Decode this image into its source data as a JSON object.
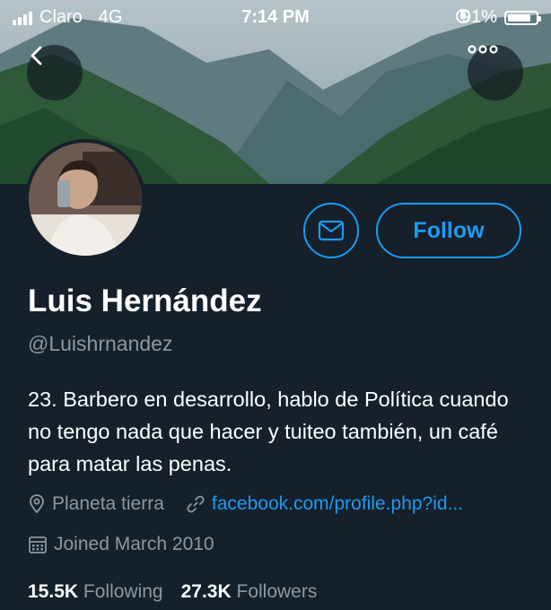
{
  "status_bar": {
    "carrier": "Claro",
    "network": "4G",
    "time": "7:14 PM",
    "battery": "91%",
    "battery_level": 0.91
  },
  "header": {
    "back_icon": "chevron-left-icon",
    "more_icon": "more-horizontal-icon"
  },
  "profile": {
    "display_name": "Luis Hernández",
    "handle": "@Luishrnandez",
    "bio": "23. Barbero en desarrollo, hablo de Política cuando no tengo nada que hacer y tuiteo también, un café para matar las penas.",
    "location": "Planeta tierra",
    "link": "facebook.com/profile.php?id...",
    "joined": "Joined March 2010"
  },
  "actions": {
    "follow_label": "Follow",
    "message_icon": "envelope-icon"
  },
  "stats": {
    "following_count": "15.5K",
    "following_label": "Following",
    "followers_count": "27.3K",
    "followers_label": "Followers"
  },
  "colors": {
    "background": "#15202b",
    "accent": "#1d9bf0",
    "secondary_text": "#8899a6"
  }
}
